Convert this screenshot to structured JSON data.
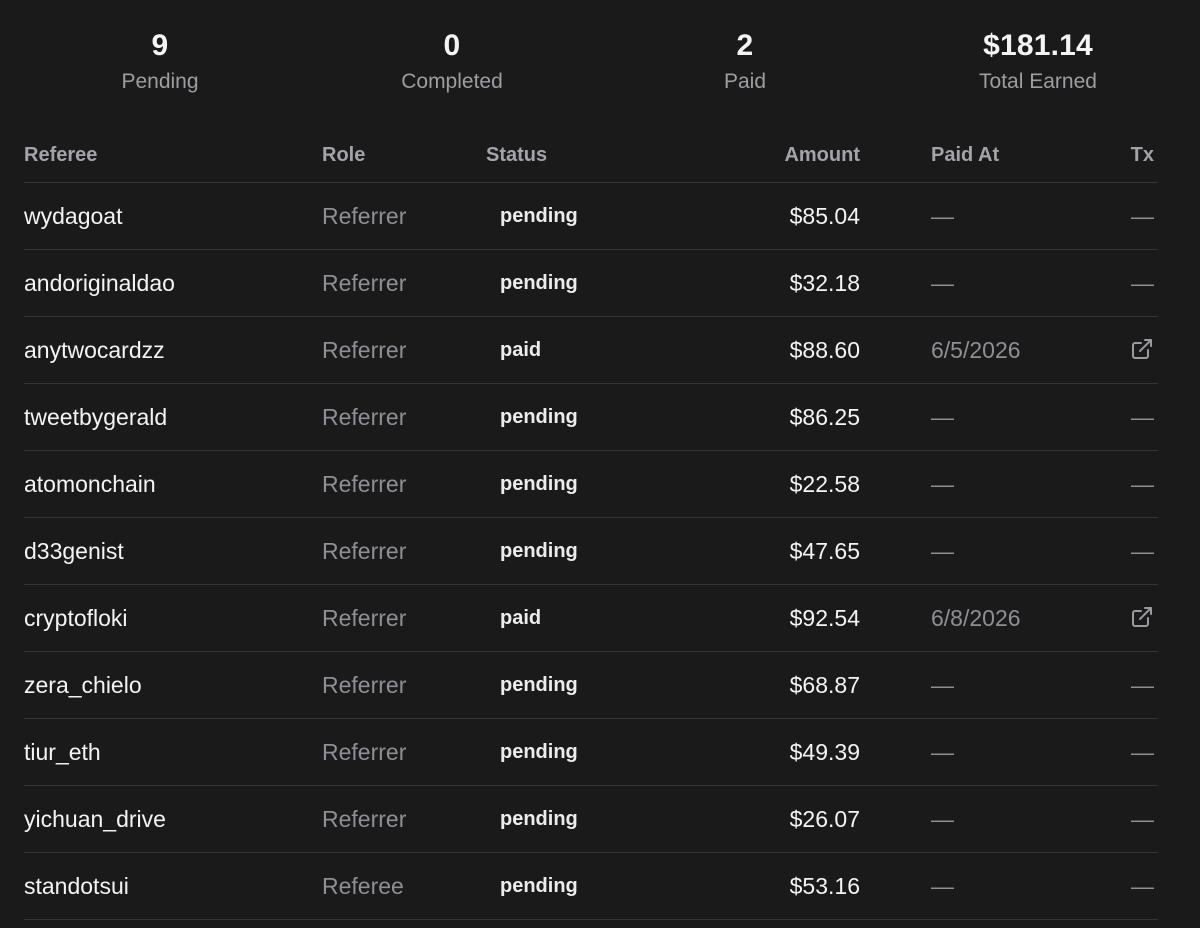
{
  "summary": {
    "pending": {
      "value": "9",
      "label": "Pending"
    },
    "completed": {
      "value": "0",
      "label": "Completed"
    },
    "paid": {
      "value": "2",
      "label": "Paid"
    },
    "total": {
      "value": "$181.14",
      "label": "Total Earned"
    }
  },
  "table": {
    "headers": {
      "referee": "Referee",
      "role": "Role",
      "status": "Status",
      "amount": "Amount",
      "paid_at": "Paid At",
      "tx": "Tx"
    },
    "tx_icon": "external-link-icon",
    "rows": [
      {
        "referee": "wydagoat",
        "role": "Referrer",
        "status": "pending",
        "amount": "$85.04",
        "paid_at": "—",
        "tx": "—"
      },
      {
        "referee": "andoriginaldao",
        "role": "Referrer",
        "status": "pending",
        "amount": "$32.18",
        "paid_at": "—",
        "tx": "—"
      },
      {
        "referee": "anytwocardzz",
        "role": "Referrer",
        "status": "paid",
        "amount": "$88.60",
        "paid_at": "6/5/2026",
        "tx": ""
      },
      {
        "referee": "tweetbygerald",
        "role": "Referrer",
        "status": "pending",
        "amount": "$86.25",
        "paid_at": "—",
        "tx": "—"
      },
      {
        "referee": "atomonchain",
        "role": "Referrer",
        "status": "pending",
        "amount": "$22.58",
        "paid_at": "—",
        "tx": "—"
      },
      {
        "referee": "d33genist",
        "role": "Referrer",
        "status": "pending",
        "amount": "$47.65",
        "paid_at": "—",
        "tx": "—"
      },
      {
        "referee": "cryptofloki",
        "role": "Referrer",
        "status": "paid",
        "amount": "$92.54",
        "paid_at": "6/8/2026",
        "tx": ""
      },
      {
        "referee": "zera_chielo",
        "role": "Referrer",
        "status": "pending",
        "amount": "$68.87",
        "paid_at": "—",
        "tx": "—"
      },
      {
        "referee": "tiur_eth",
        "role": "Referrer",
        "status": "pending",
        "amount": "$49.39",
        "paid_at": "—",
        "tx": "—"
      },
      {
        "referee": "yichuan_drive",
        "role": "Referrer",
        "status": "pending",
        "amount": "$26.07",
        "paid_at": "—",
        "tx": "—"
      },
      {
        "referee": "standotsui",
        "role": "Referee",
        "status": "pending",
        "amount": "$53.16",
        "paid_at": "—",
        "tx": "—"
      }
    ]
  }
}
